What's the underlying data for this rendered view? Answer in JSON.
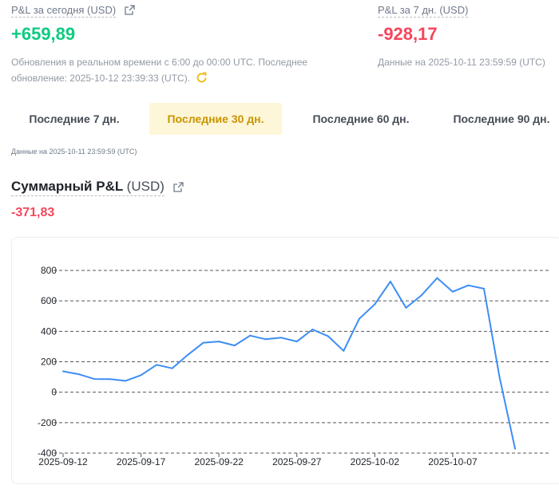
{
  "today": {
    "label": "P&L за сегодня (USD)",
    "value": "+659,89",
    "note_line1": "Обновления в реальном времени с 6:00 до 00:00 UTC. Последнее",
    "note_line2": "обновление: 2025-10-12 23:39:33 (UTC)."
  },
  "week": {
    "label": "P&L за 7 дн. (USD)",
    "value": "-928,17",
    "note": "Данные на 2025-10-11 23:59:59 (UTC)"
  },
  "tabs": [
    {
      "label": "Последние 7 дн.",
      "active": false
    },
    {
      "label": "Последние 30 дн.",
      "active": true
    },
    {
      "label": "Последние 60 дн.",
      "active": false
    },
    {
      "label": "Последние 90 дн.",
      "active": false
    }
  ],
  "period_note": "Данные на 2025-10-11 23:59:59 (UTC)",
  "cumulative": {
    "title": "Суммарный P&L",
    "unit": "(USD)",
    "value": "-371,83"
  },
  "colors": {
    "positive": "#0ecb81",
    "negative": "#f6465d",
    "accent": "#f0b90b",
    "line": "#3d8df5"
  },
  "chart_data": {
    "type": "line",
    "x": [
      "2025-09-12",
      "2025-09-13",
      "2025-09-14",
      "2025-09-15",
      "2025-09-16",
      "2025-09-17",
      "2025-09-18",
      "2025-09-19",
      "2025-09-20",
      "2025-09-21",
      "2025-09-22",
      "2025-09-23",
      "2025-09-24",
      "2025-09-25",
      "2025-09-26",
      "2025-09-27",
      "2025-09-28",
      "2025-09-29",
      "2025-09-30",
      "2025-10-01",
      "2025-10-02",
      "2025-10-03",
      "2025-10-04",
      "2025-10-05",
      "2025-10-06",
      "2025-10-07",
      "2025-10-08",
      "2025-10-09",
      "2025-10-10",
      "2025-10-11"
    ],
    "y": [
      137,
      118,
      87,
      86,
      75,
      112,
      180,
      157,
      245,
      325,
      333,
      307,
      372,
      348,
      358,
      333,
      412,
      368,
      272,
      482,
      578,
      727,
      555,
      637,
      750,
      660,
      702,
      680,
      100,
      -371.83
    ],
    "xticks": [
      "2025-09-12",
      "2025-09-17",
      "2025-09-22",
      "2025-09-27",
      "2025-10-02",
      "2025-10-07"
    ],
    "yticks": [
      800,
      600,
      400,
      200,
      0,
      -200,
      -400
    ],
    "ylim": [
      -400,
      800
    ],
    "grid": true
  }
}
